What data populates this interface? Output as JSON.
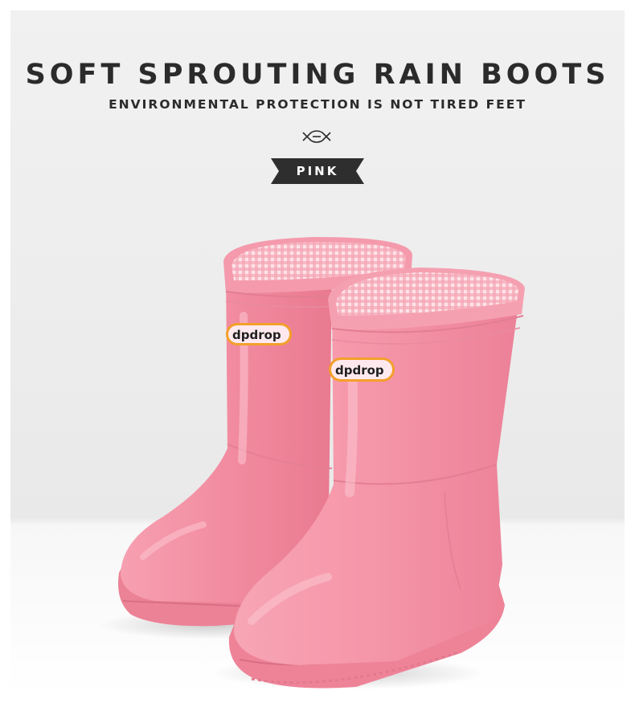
{
  "heading": {
    "title": "SOFT SPROUTING RAIN BOOTS",
    "subtitle": "ENVIRONMENTAL PROTECTION IS NOT TIRED FEET"
  },
  "badge": {
    "label": "PINK"
  },
  "product": {
    "brand_logo_text": "dpdrop",
    "boot_color": "#f48ea2",
    "sole_color": "#ee8396",
    "lining_color": "#f7b3c0"
  },
  "ornament": {
    "icon": "knot-icon"
  }
}
